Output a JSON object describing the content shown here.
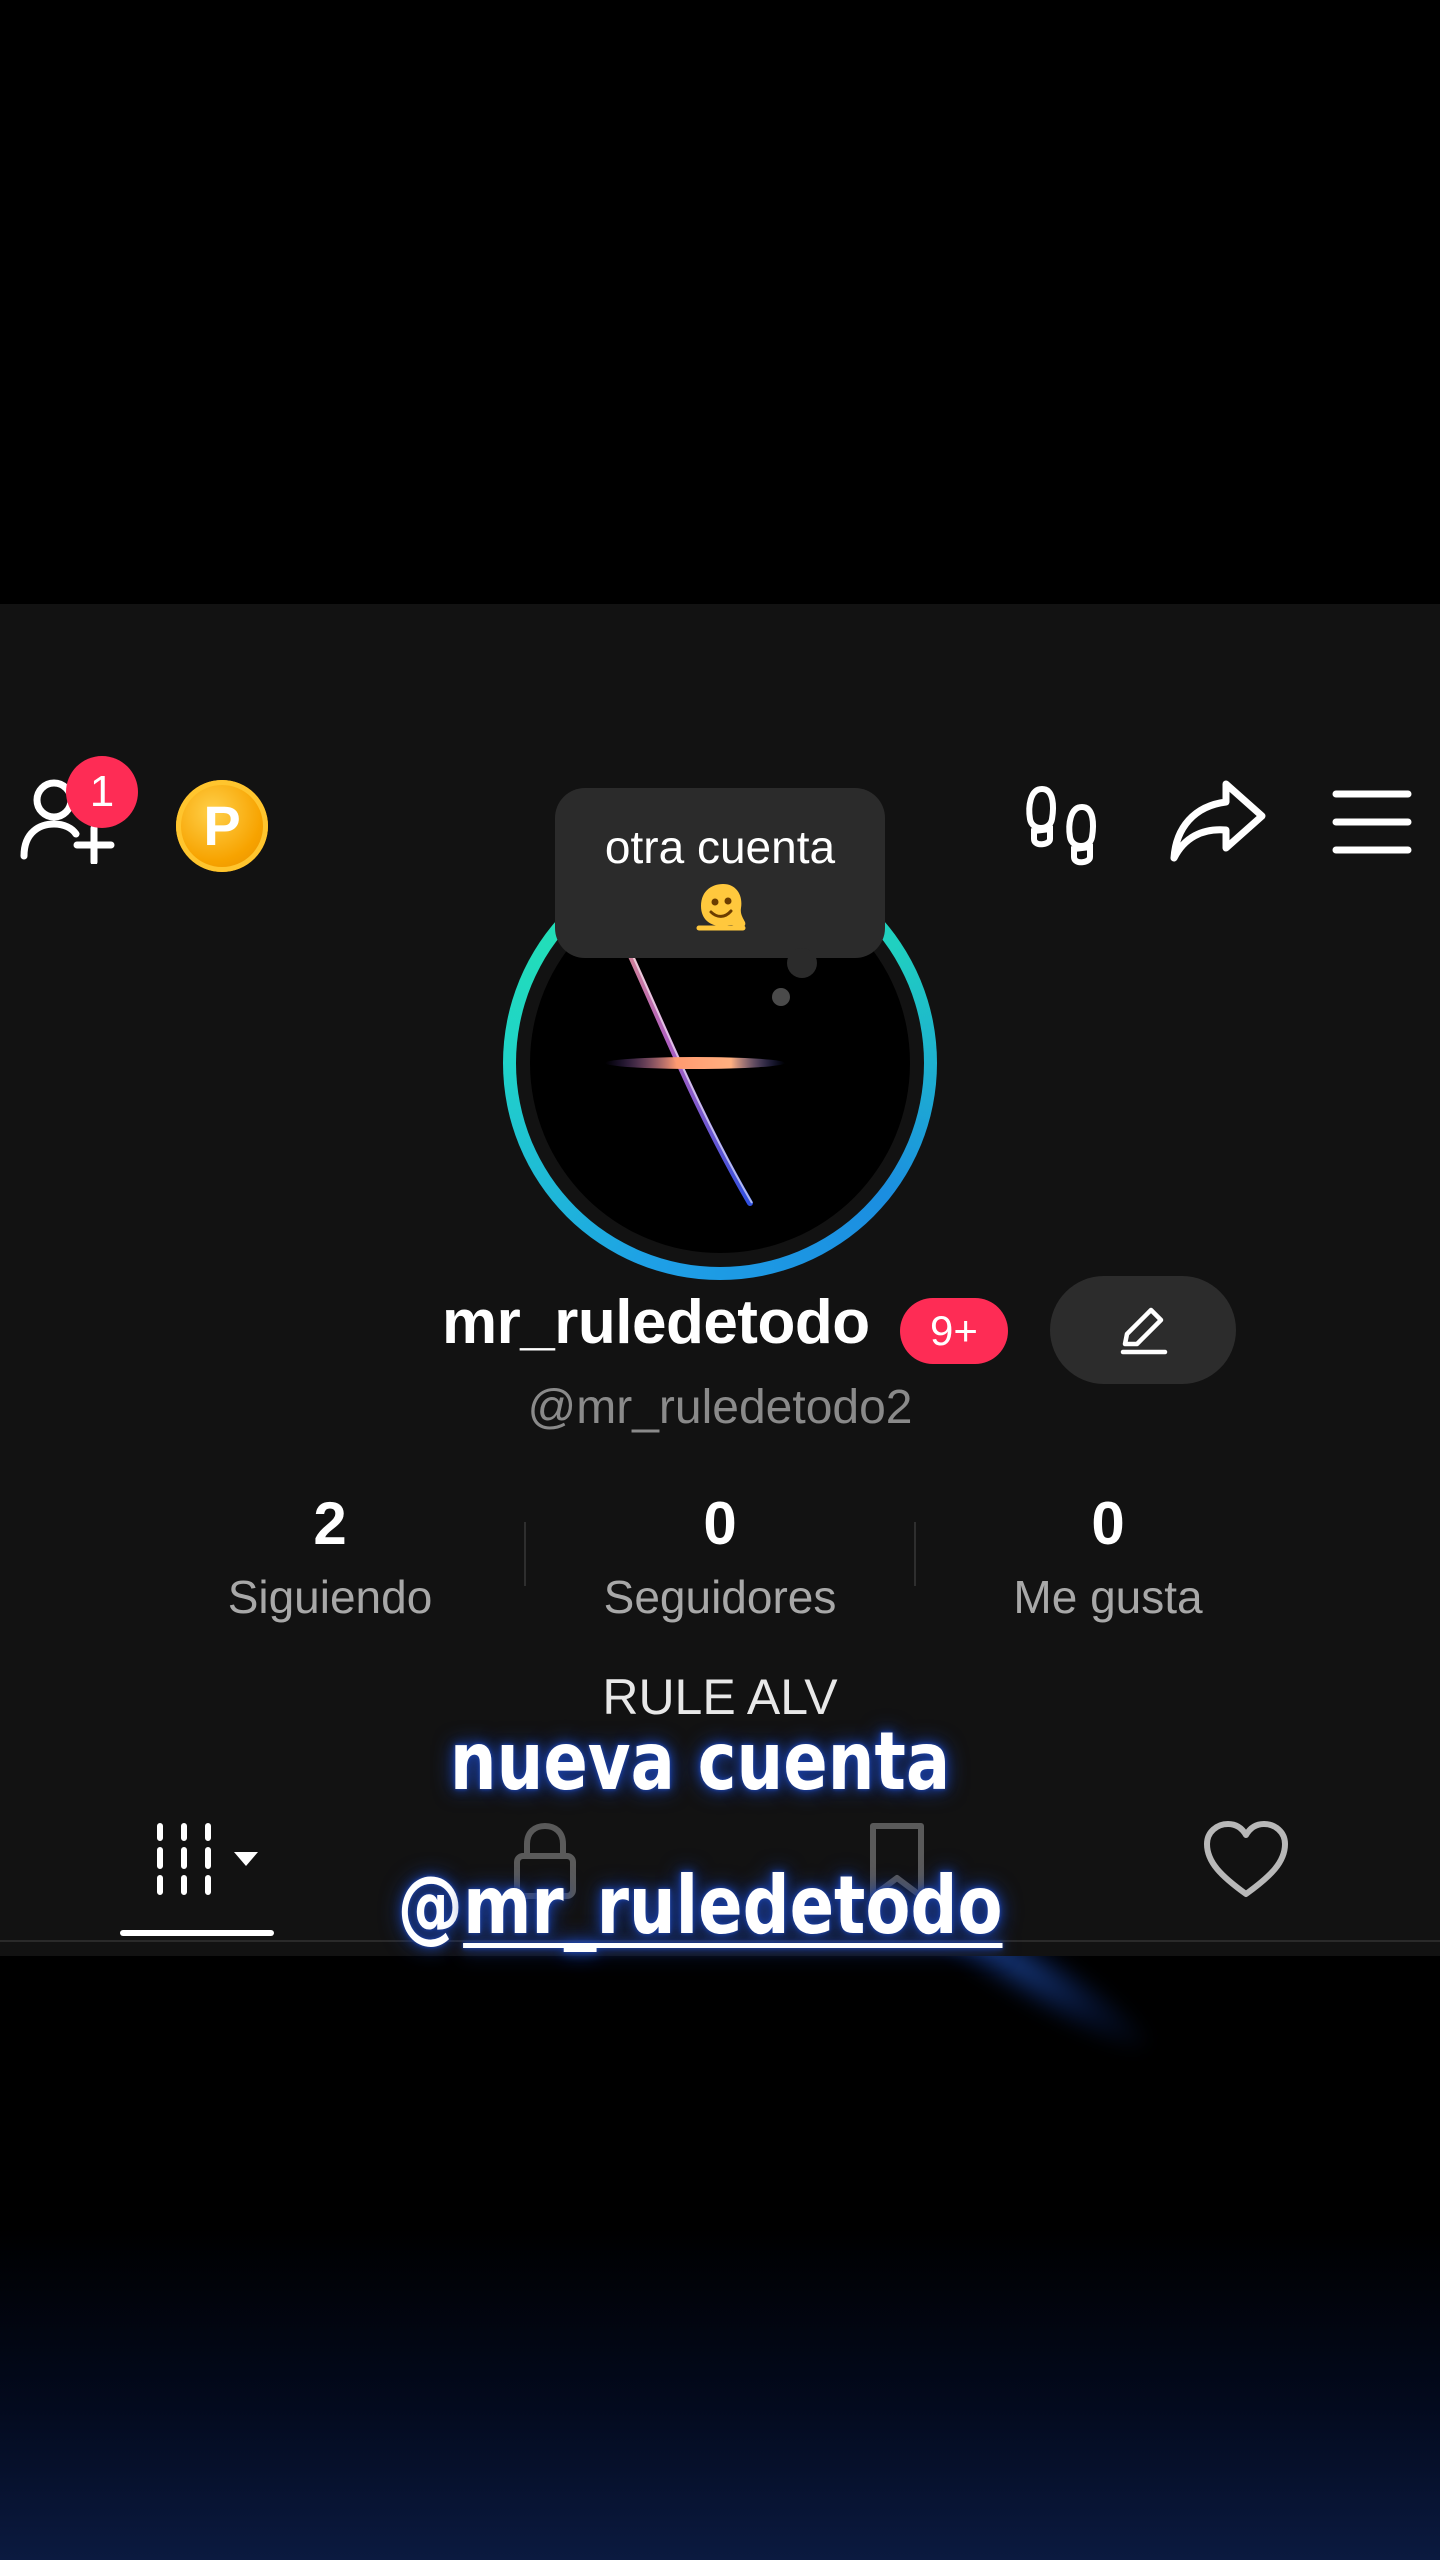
{
  "notifications": {
    "friend_requests": "1",
    "name_badge": "9+"
  },
  "coin": {
    "letter": "P"
  },
  "tooltip": {
    "text": "otra cuenta",
    "emoji": "melting-face-emoji"
  },
  "profile": {
    "name": "mr_ruledetodo",
    "handle": "@mr_ruledetodo2",
    "bio": "RULE ALV"
  },
  "stats": [
    {
      "value": "2",
      "label": "Siguiendo"
    },
    {
      "value": "0",
      "label": "Seguidores"
    },
    {
      "value": "0",
      "label": "Me gusta"
    }
  ],
  "tabs": [
    {
      "icon": "videos-grid-icon",
      "active": true
    },
    {
      "icon": "lock-icon",
      "active": false
    },
    {
      "icon": "bookmark-icon",
      "active": false
    },
    {
      "icon": "heart-icon",
      "active": false
    }
  ],
  "overlay": {
    "line1": "nueva cuenta",
    "line2_prefix": "@",
    "line2_link": "mr_ruledetodo"
  },
  "colors": {
    "accent_red": "#fe2c55",
    "ring_blue": "#1ea0e6",
    "ring_green": "#24e8a8",
    "plus_blue": "#1fb6e8",
    "coin_orange": "#f7a300"
  }
}
